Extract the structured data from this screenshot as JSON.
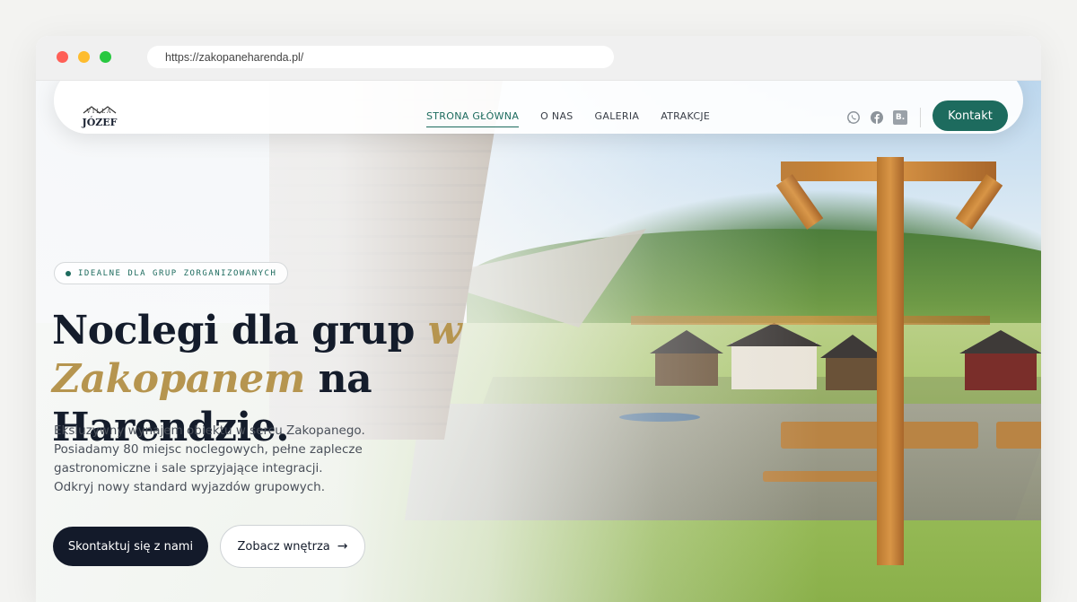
{
  "browser": {
    "url": "https://zakopaneharenda.pl/"
  },
  "logo": {
    "top_text": "VILLA",
    "name": "JÓZEF"
  },
  "nav": {
    "items": [
      {
        "label": "STRONA GŁÓWNA",
        "active": true
      },
      {
        "label": "O NAS",
        "active": false
      },
      {
        "label": "GALERIA",
        "active": false
      },
      {
        "label": "ATRAKCJE",
        "active": false
      }
    ],
    "socials": [
      "whatsapp-icon",
      "facebook-icon",
      "booking-icon"
    ],
    "booking_letter": "B.",
    "contact_label": "Kontakt"
  },
  "hero": {
    "badge": "IDEALNE DLA GRUP ZORGANIZOWANYCH",
    "headline_part1": "Noclegi dla grup ",
    "headline_gold1": "w",
    "headline_gold2": "Zakopanem",
    "headline_part2": " na Harendzie.",
    "description_lines": [
      "Eksluzywny wynajem obiektu w sercu Zakopanego.",
      "Posiadamy 80 miejsc noclegowych, pełne zaplecze",
      "gastronomiczne i sale sprzyjające integracji.",
      "Odkryj nowy standard wyjazdów grupowych."
    ],
    "primary_button": "Skontaktuj się z nami",
    "secondary_button": "Zobacz wnętrza",
    "secondary_arrow": "→"
  },
  "colors": {
    "accent": "#1d6b5e",
    "gold": "#b6954f",
    "dark": "#131a2a"
  }
}
